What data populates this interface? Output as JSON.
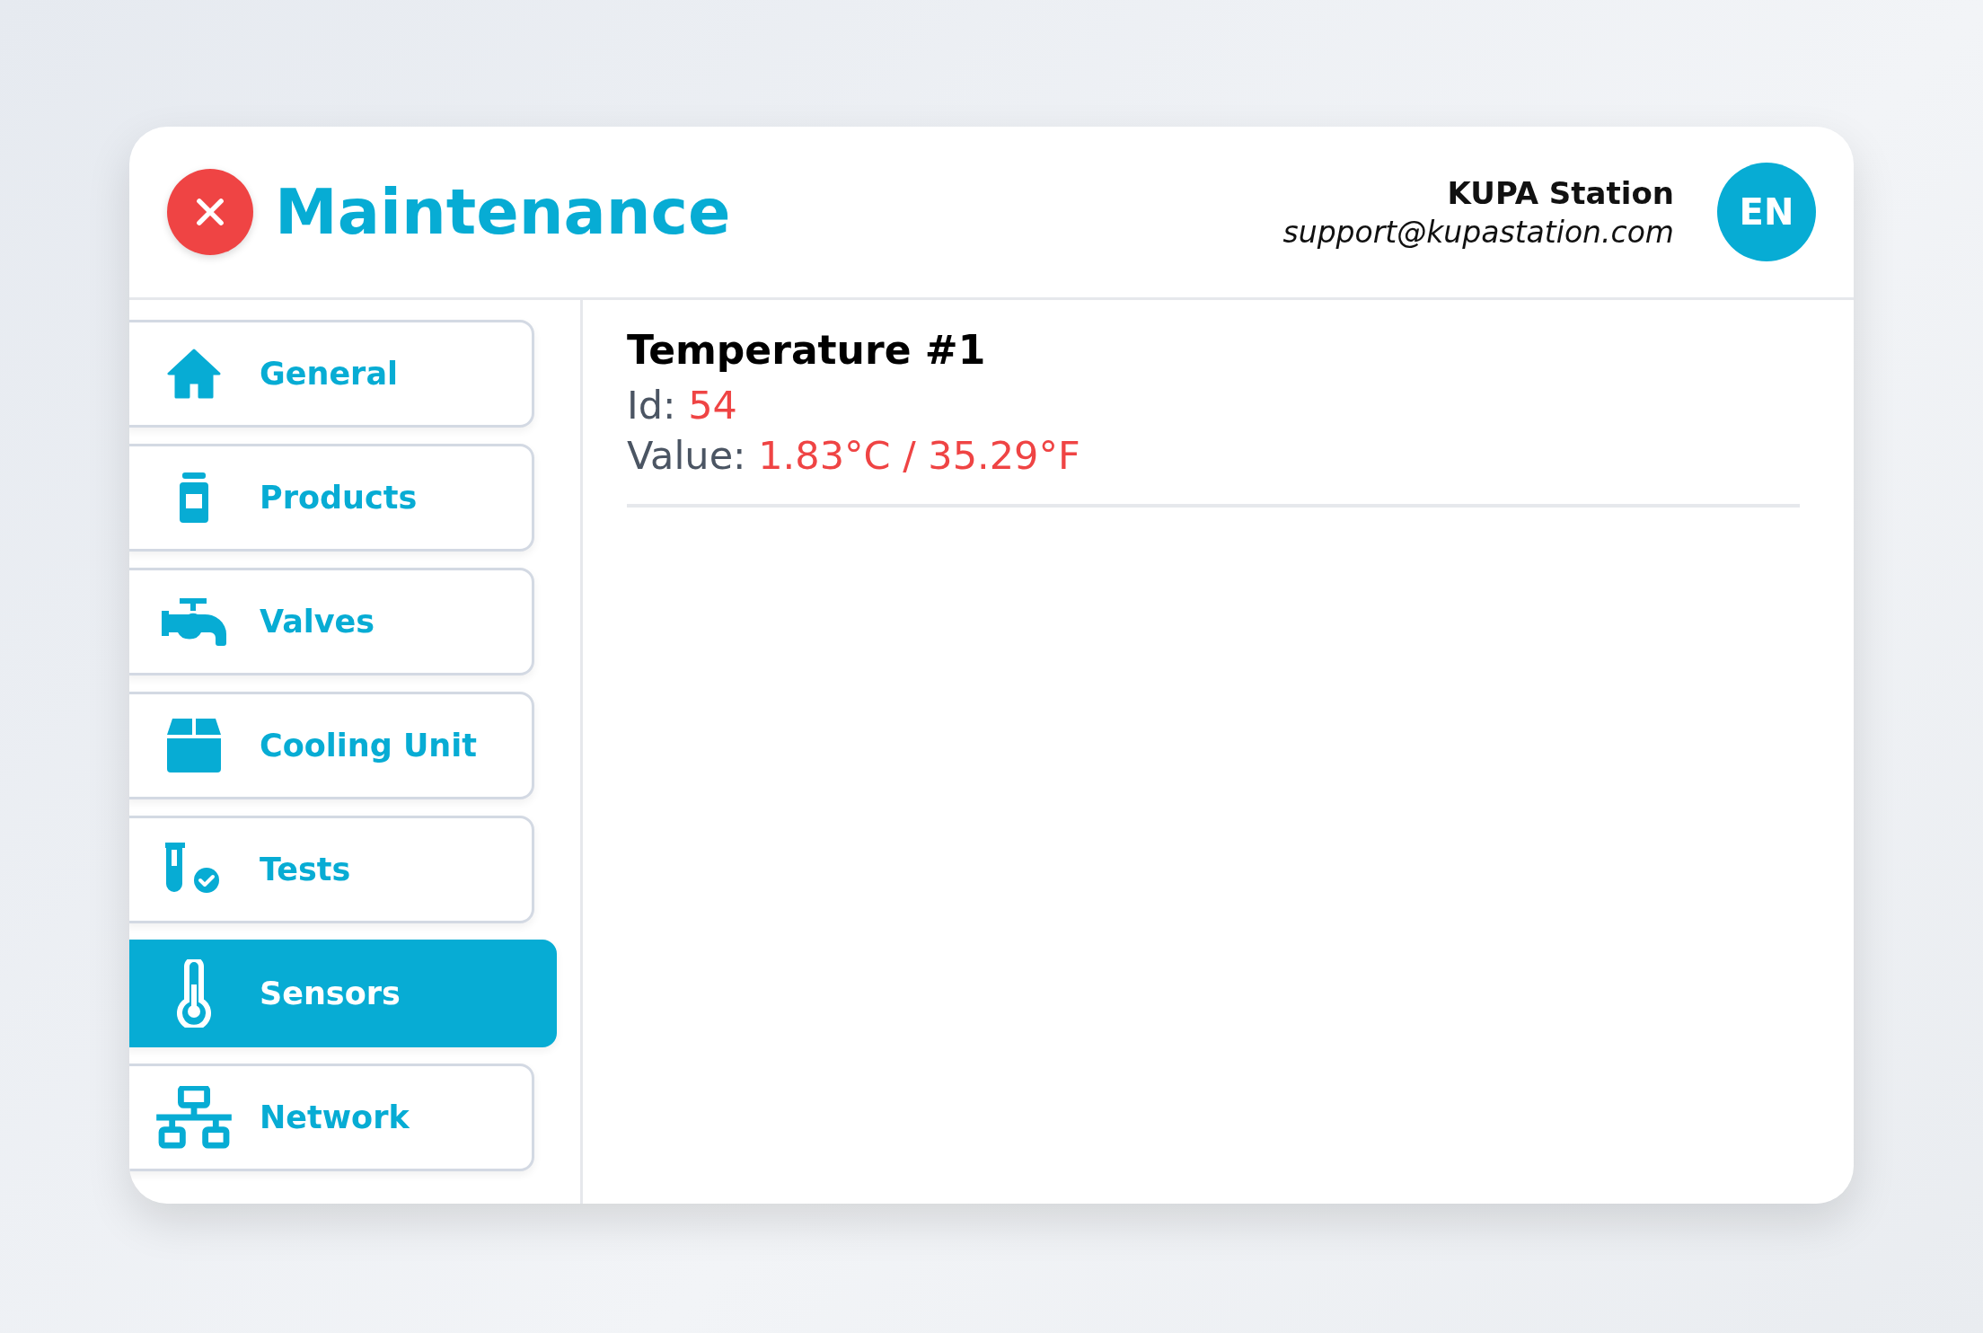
{
  "header": {
    "title": "Maintenance",
    "station_name": "KUPA Station",
    "support_email": "support@kupastation.com",
    "language": "EN"
  },
  "sidebar": {
    "items": [
      {
        "label": "General",
        "kind": "home",
        "selected": false
      },
      {
        "label": "Products",
        "kind": "jar",
        "selected": false
      },
      {
        "label": "Valves",
        "kind": "tap",
        "selected": false
      },
      {
        "label": "Cooling Unit",
        "kind": "box",
        "selected": false
      },
      {
        "label": "Tests",
        "kind": "test-tube",
        "selected": false
      },
      {
        "label": "Sensors",
        "kind": "thermometer",
        "selected": true
      },
      {
        "label": "Network",
        "kind": "network",
        "selected": false
      }
    ]
  },
  "sensor": {
    "title": "Temperature #1",
    "fields": [
      {
        "label": "Id:",
        "value": "54"
      },
      {
        "label": "Value:",
        "value": "1.83°C / 35.29°F"
      }
    ]
  }
}
